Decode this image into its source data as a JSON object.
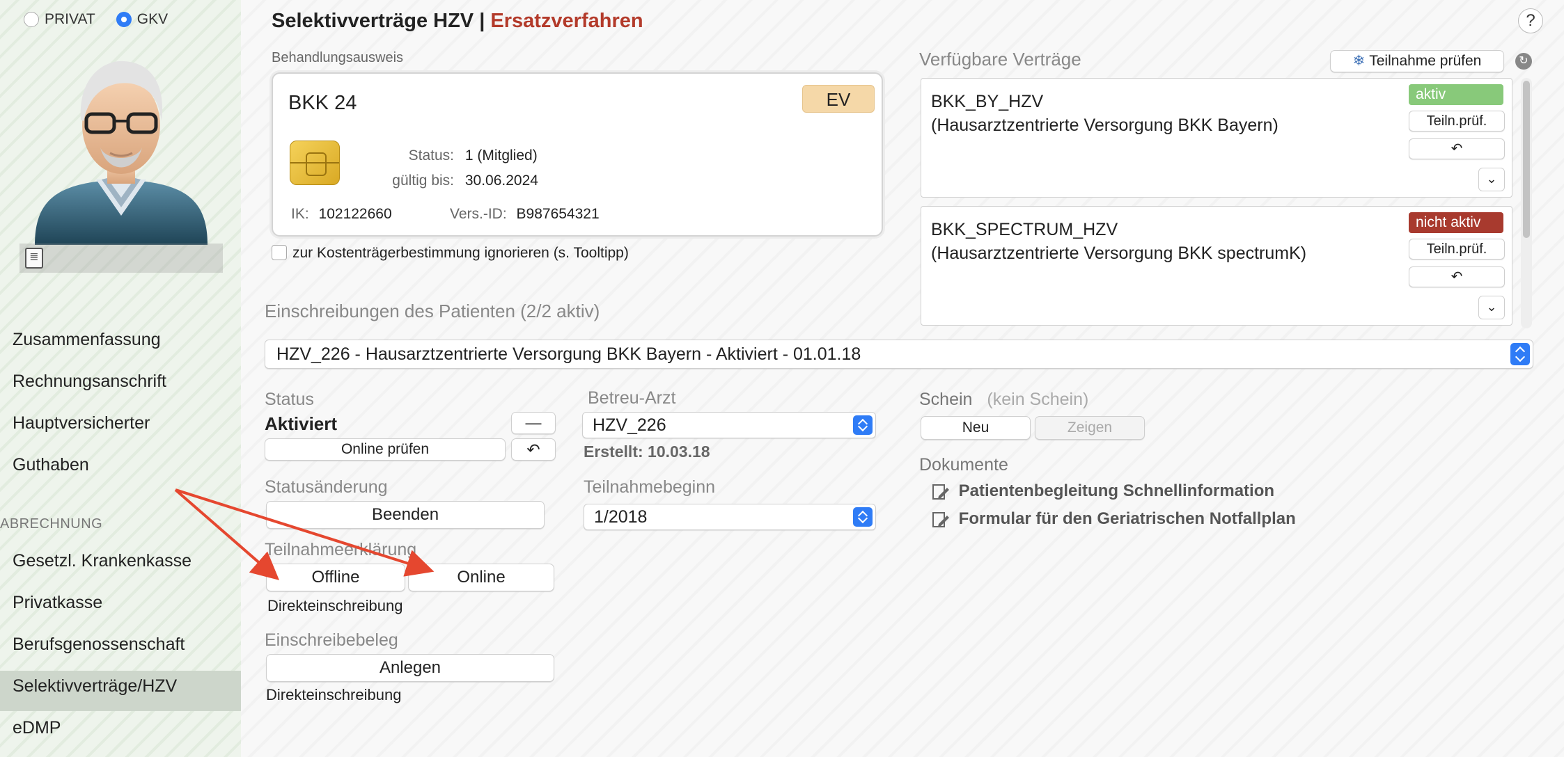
{
  "insurance_type": {
    "options": [
      "PRIVAT",
      "GKV"
    ],
    "selected": "GKV"
  },
  "sidebar": {
    "items": [
      {
        "label": "Zusammenfassung"
      },
      {
        "label": "Rechnungsanschrift"
      },
      {
        "label": "Hauptversicherter"
      },
      {
        "label": "Guthaben"
      }
    ],
    "section_label": "ABRECHNUNG",
    "billing_items": [
      {
        "label": "Gesetzl. Krankenkasse"
      },
      {
        "label": "Privatkasse"
      },
      {
        "label": "Berufsgenossenschaft"
      },
      {
        "label": "Selektivverträge/HZV"
      },
      {
        "label": "eDMP"
      }
    ],
    "active_item": "Selektivverträge/HZV"
  },
  "header": {
    "title": "Selektivverträge HZV |",
    "title_accent": "Ersatzverfahren",
    "help": "?"
  },
  "card": {
    "section_label": "Behandlungsausweis",
    "kasse": "BKK 24",
    "badge": "EV",
    "status_key": "Status:",
    "status_value": "1 (Mitglied)",
    "valid_key": "gültig bis:",
    "valid_value": "30.06.2024",
    "ik_key": "IK:",
    "ik_value": "102122660",
    "vers_key": "Vers.-ID:",
    "vers_value": "B987654321"
  },
  "ignore_checkbox": {
    "label": "zur Kostenträgerbestimmung ignorieren (s. Tooltipp)",
    "checked": false
  },
  "contracts": {
    "section_label": "Verfügbare Verträge",
    "check_button": "Teilnahme prüfen",
    "items": [
      {
        "code": "BKK_BY_HZV",
        "description": "(Hausarztzentrierte Versorgung BKK Bayern)",
        "status": "aktiv",
        "check_label": "Teiln.prüf."
      },
      {
        "code": "BKK_SPECTRUM_HZV",
        "description": "(Hausarztzentrierte Versorgung BKK spectrumK)",
        "status": "nicht aktiv",
        "check_label": "Teiln.prüf."
      }
    ]
  },
  "enrollments": {
    "section_label": "Einschreibungen des Patienten (2/2 aktiv)",
    "selected": "HZV_226 - Hausarztzentrierte Versorgung BKK Bayern - Aktiviert - 01.01.18"
  },
  "status": {
    "label": "Status",
    "value": "Aktiviert",
    "minus": "—",
    "online_check": "Online prüfen"
  },
  "status_change": {
    "label": "Statusänderung",
    "button": "Beenden"
  },
  "participation": {
    "label": "Teilnahmeerklärung",
    "offline": "Offline",
    "online": "Online",
    "note": "Direkteinschreibung"
  },
  "receipt": {
    "label": "Einschreibebeleg",
    "button": "Anlegen",
    "note": "Direkteinschreibung"
  },
  "doctor": {
    "label": "Betreu-Arzt",
    "selected": "HZV_226",
    "created": "Erstellt: 10.03.18"
  },
  "start": {
    "label": "Teilnahmebeginn",
    "selected": "1/2018"
  },
  "schein": {
    "label": "Schein",
    "hint": "(kein Schein)",
    "new": "Neu",
    "show": "Zeigen"
  },
  "documents": {
    "label": "Dokumente",
    "items": [
      "Patientenbegleitung Schnellinformation",
      "Formular für den Geriatrischen Notfallplan"
    ]
  },
  "colors": {
    "accent_red": "#b33a2a",
    "active_green": "#88c97a",
    "inactive_red": "#a83a2e",
    "select_blue": "#2f7cf6",
    "annotation_arrow": "#e5472f"
  }
}
